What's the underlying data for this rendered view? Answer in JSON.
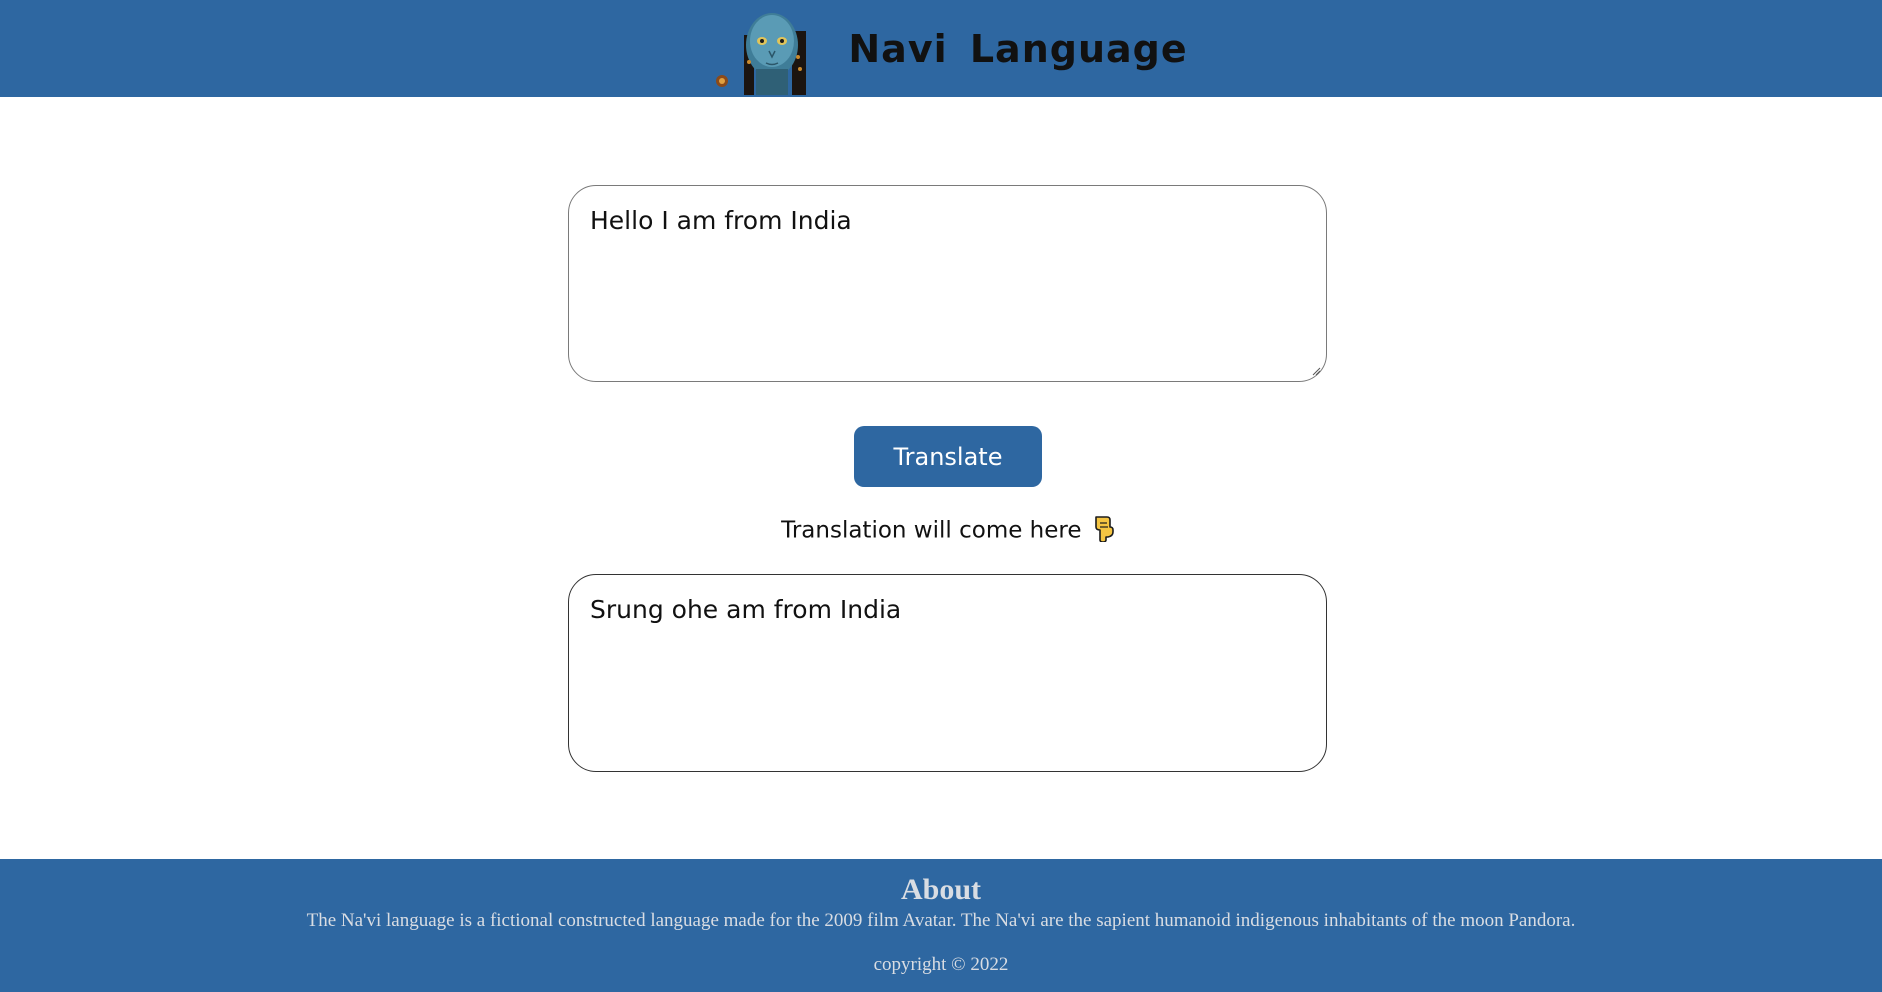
{
  "header": {
    "title": "Navi  Language",
    "logo_icon": "navi-avatar-icon"
  },
  "colors": {
    "brand": "#2e67a1",
    "background": "#ffffff",
    "footer_text": "#d9dde3"
  },
  "main": {
    "input_value": "Hello I am from India",
    "translate_label": "Translate",
    "output_label": "Translation will come here",
    "output_label_icon": "pointing-down-hand-icon",
    "output_value": "Srung ohe am from India"
  },
  "footer": {
    "title": "About",
    "description": "The Na'vi language is a fictional constructed language made for the 2009 film Avatar. The Na'vi are the sapient humanoid indigenous inhabitants of the moon Pandora.",
    "copyright": "copyright © 2022"
  }
}
